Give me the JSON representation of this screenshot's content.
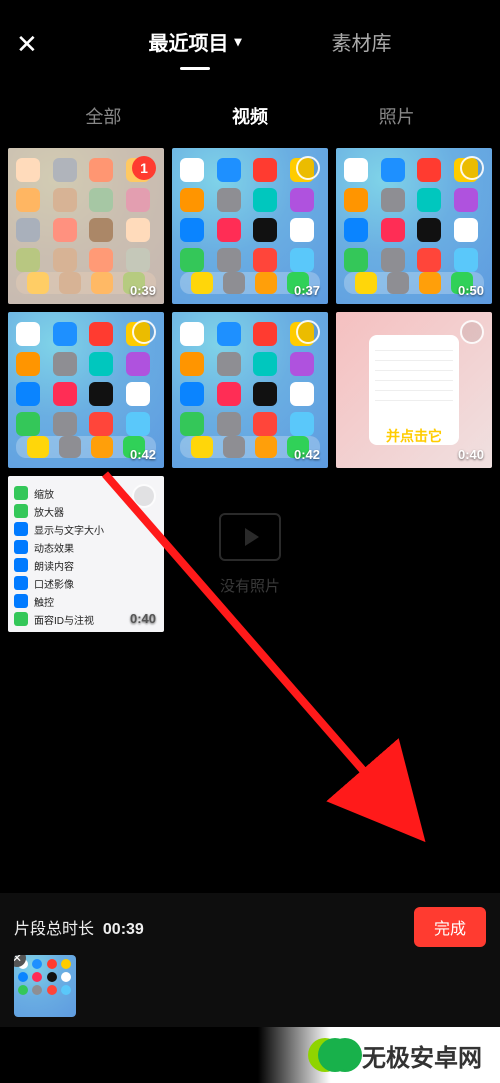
{
  "topnav": {
    "tabs": [
      {
        "label": "最近项目",
        "active": true
      },
      {
        "label": "素材库",
        "active": false
      }
    ]
  },
  "filters": {
    "tabs": [
      {
        "label": "全部",
        "active": false
      },
      {
        "label": "视频",
        "active": true
      },
      {
        "label": "照片",
        "active": false
      }
    ]
  },
  "grid": {
    "items": [
      {
        "kind": "ios-blue",
        "duration": "0:39",
        "selected_index": "1",
        "tint": "peach"
      },
      {
        "kind": "ios-blue",
        "duration": "0:37"
      },
      {
        "kind": "ios-blue",
        "duration": "0:50"
      },
      {
        "kind": "ios-blue",
        "duration": "0:42"
      },
      {
        "kind": "ios-blue",
        "duration": "0:42"
      },
      {
        "kind": "modal",
        "duration": "0:40",
        "caption": "并点击它"
      },
      {
        "kind": "settings",
        "duration": "0:40"
      }
    ],
    "empty_label": "没有照片"
  },
  "settings_rows": [
    {
      "label": "缩放",
      "color": "#34c759"
    },
    {
      "label": "放大器",
      "color": "#34c759"
    },
    {
      "label": "显示与文字大小",
      "color": "#007aff"
    },
    {
      "label": "动态效果",
      "color": "#007aff"
    },
    {
      "label": "朗读内容",
      "color": "#007aff"
    },
    {
      "label": "口述影像",
      "color": "#007aff"
    },
    {
      "label": "触控",
      "color": "#007aff"
    },
    {
      "label": "面容ID与注视",
      "color": "#34c759"
    }
  ],
  "bottom": {
    "label_prefix": "片段总时长",
    "total_time": "00:39",
    "done": "完成"
  },
  "watermark": {
    "text": "无极安卓网"
  }
}
